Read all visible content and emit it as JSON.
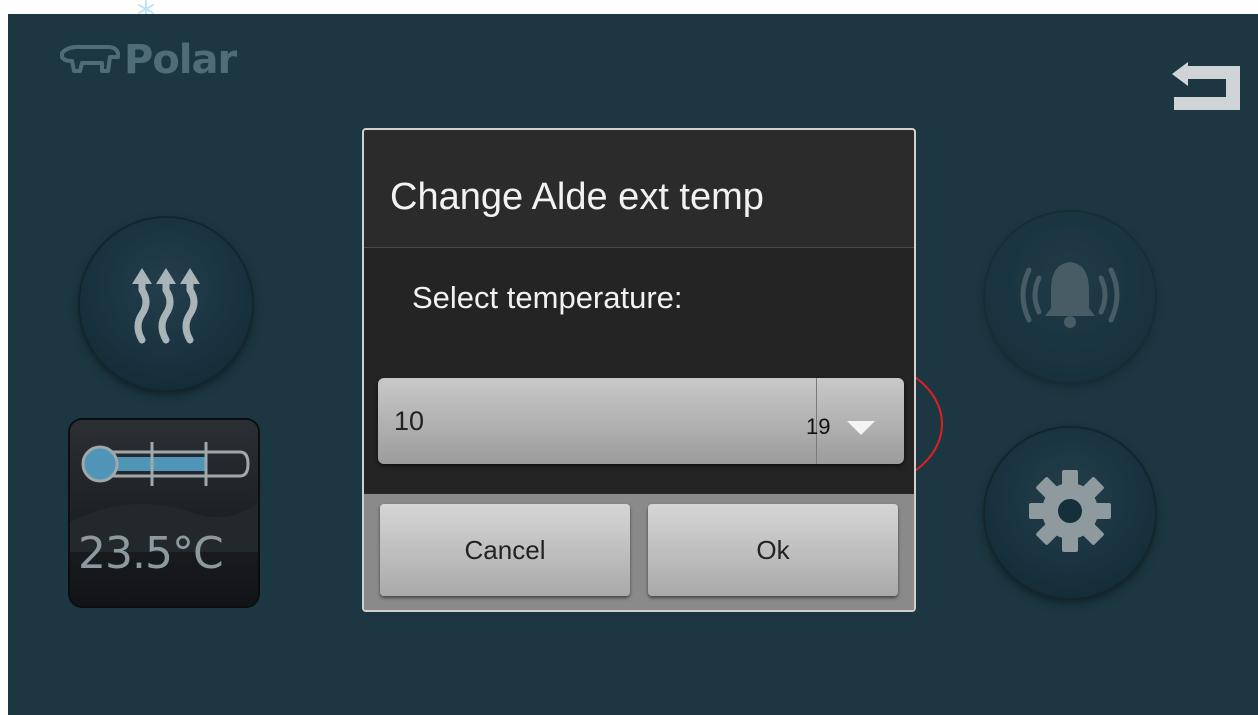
{
  "brand": {
    "name": "Polar"
  },
  "status": {
    "temperature": "23.5°C"
  },
  "dialog": {
    "title": "Change Alde ext temp",
    "label": "Select temperature:",
    "spinner": {
      "value": "10",
      "annotation": "19"
    },
    "cancel_label": "Cancel",
    "ok_label": "Ok"
  },
  "icons": {
    "brand": "polar-bear-icon",
    "back": "back-arrow-icon",
    "heat": "heating-waves-icon",
    "bell": "alarm-bell-icon",
    "settings": "gear-icon",
    "thermometer": "thermometer-icon",
    "dropdown": "triangle-down-icon"
  },
  "colors": {
    "screen_bg": "#1c3742",
    "dialog_bg": "#2b2b2b",
    "highlight": "#e02020"
  }
}
